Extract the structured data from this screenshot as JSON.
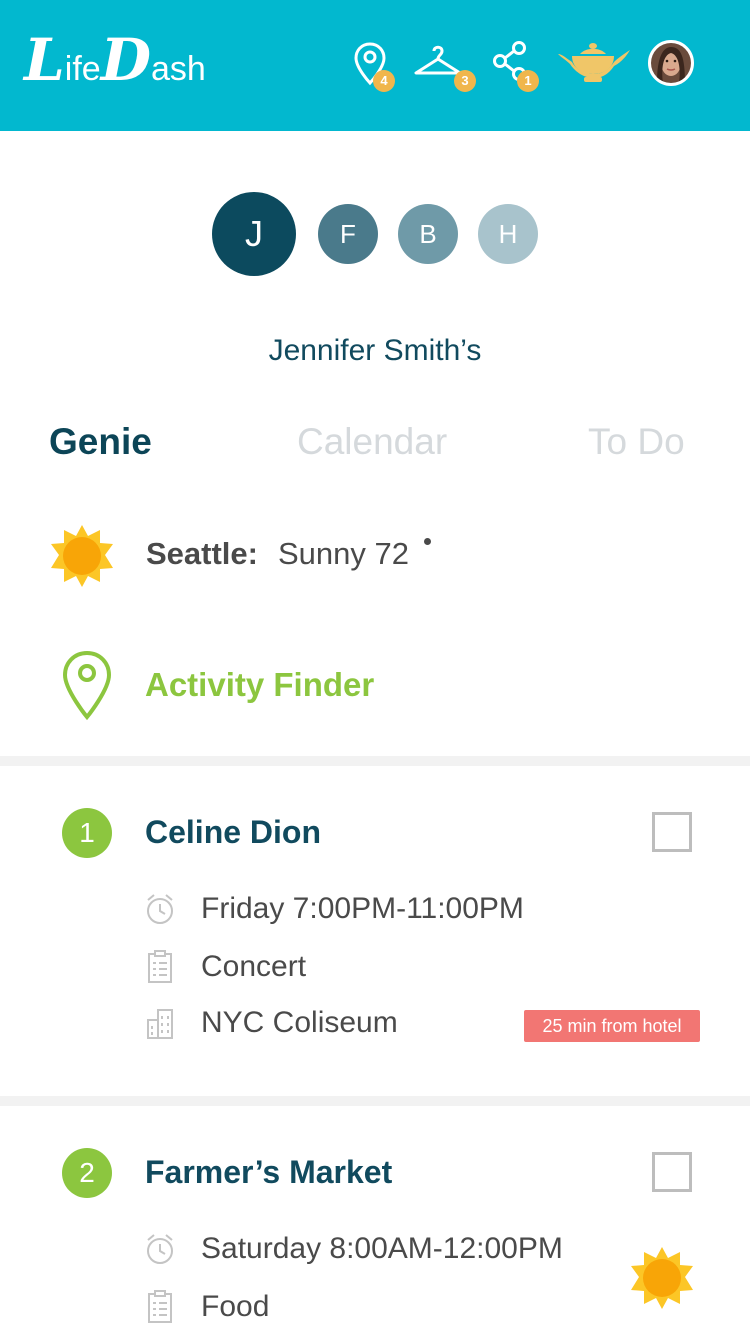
{
  "header": {
    "logo_big_1": "L",
    "logo_small_1": "ife",
    "logo_big_2": "D",
    "logo_small_2": "ash",
    "icons": [
      {
        "name": "location-pin-icon",
        "badge": "4"
      },
      {
        "name": "hanger-icon",
        "badge": "3"
      },
      {
        "name": "share-icon",
        "badge": "1"
      },
      {
        "name": "genie-lamp-icon"
      }
    ],
    "colors": {
      "bar": "#02b8cf",
      "badge": "#f0b64c"
    }
  },
  "profiles": [
    {
      "initial": "J",
      "color": "#0c4a5e"
    },
    {
      "initial": "F",
      "color": "#4a7a8b"
    },
    {
      "initial": "B",
      "color": "#6f9aa8"
    },
    {
      "initial": "H",
      "color": "#a8c3cc"
    }
  ],
  "owner_label": "Jennifer Smith’s",
  "tabs": [
    {
      "label": "Genie",
      "active": true
    },
    {
      "label": "Calendar",
      "active": false
    },
    {
      "label": "To Do",
      "active": false
    }
  ],
  "weather": {
    "city": "Seattle:",
    "condition": "Sunny 72",
    "icon": "sun-icon"
  },
  "activity_finder": {
    "label": "Activity Finder",
    "icon": "location-pin-icon",
    "color": "#8cc63f"
  },
  "activities": [
    {
      "number": "1",
      "title": "Celine Dion",
      "time": "Friday 7:00PM-11:00PM",
      "category": "Concert",
      "venue": "NYC Coliseum",
      "distance": "25 min from hotel"
    },
    {
      "number": "2",
      "title": "Farmer’s Market",
      "time": "Saturday 8:00AM-12:00PM",
      "category": "Food",
      "weather_icon": "sun-icon"
    }
  ]
}
